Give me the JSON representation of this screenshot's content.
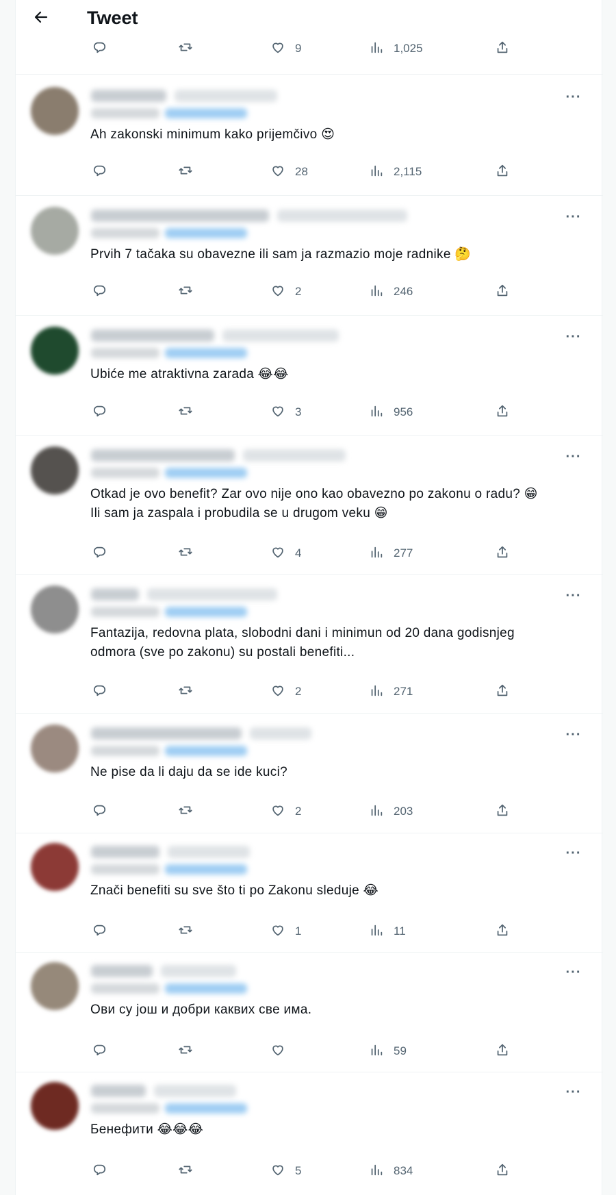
{
  "header": {
    "title": "Tweet",
    "back_icon": "arrow-left-icon"
  },
  "colors": {
    "text": "#0f1419",
    "muted": "#536471",
    "blurred_handle": "#c8cdd2",
    "blurred_mention": "#9ecdf3"
  },
  "main_tweet_stats": {
    "replies": "",
    "retweets": "",
    "likes": "9",
    "views": "1,025"
  },
  "replies": [
    {
      "text": "Ah zakonski minimum kako prijemčivo 😍",
      "likes": "28",
      "views": "2,115",
      "avatar_color": "#8a7d6e"
    },
    {
      "text": "Prvih 7 tačaka su obavezne ili sam ja razmazio moje radnike 🤔",
      "likes": "2",
      "views": "246",
      "avatar_color": "#a6aaa3"
    },
    {
      "text": "Ubiće me atraktivna zarada 😂😂",
      "likes": "3",
      "views": "956",
      "avatar_color": "#1f4a2e"
    },
    {
      "text": "Otkad je ovo benefit? Zar ovo nije ono kao obavezno po zakonu o radu? 😁\nIli sam ja zaspala i probudila se u drugom veku 😁",
      "likes": "4",
      "views": "277",
      "avatar_color": "#55524f"
    },
    {
      "text": "Fantazija, redovna plata, slobodni dani i minimun od 20 dana godisnjeg\nodmora (sve po zakonu) su postali benefiti...",
      "likes": "2",
      "views": "271",
      "avatar_color": "#8e8e8e"
    },
    {
      "text": "Ne pise da li daju da se ide kuci?",
      "likes": "2",
      "views": "203",
      "avatar_color": "#9b8a80"
    },
    {
      "text": "Znači benefiti su sve što ti po Zakonu sleduje 😂",
      "likes": "1",
      "views": "11",
      "avatar_color": "#8c3a36"
    },
    {
      "text": "Ови су још и добри каквих све има.",
      "likes": "",
      "views": "59",
      "avatar_color": "#96897a"
    },
    {
      "text": "Бенефити 😂😂😂",
      "likes": "5",
      "views": "834",
      "avatar_color": "#6e2a22"
    }
  ],
  "icons": {
    "reply": "reply-icon",
    "retweet": "retweet-icon",
    "like": "heart-icon",
    "views": "views-icon",
    "share": "share-icon",
    "more": "more-icon"
  },
  "more_label": "···"
}
